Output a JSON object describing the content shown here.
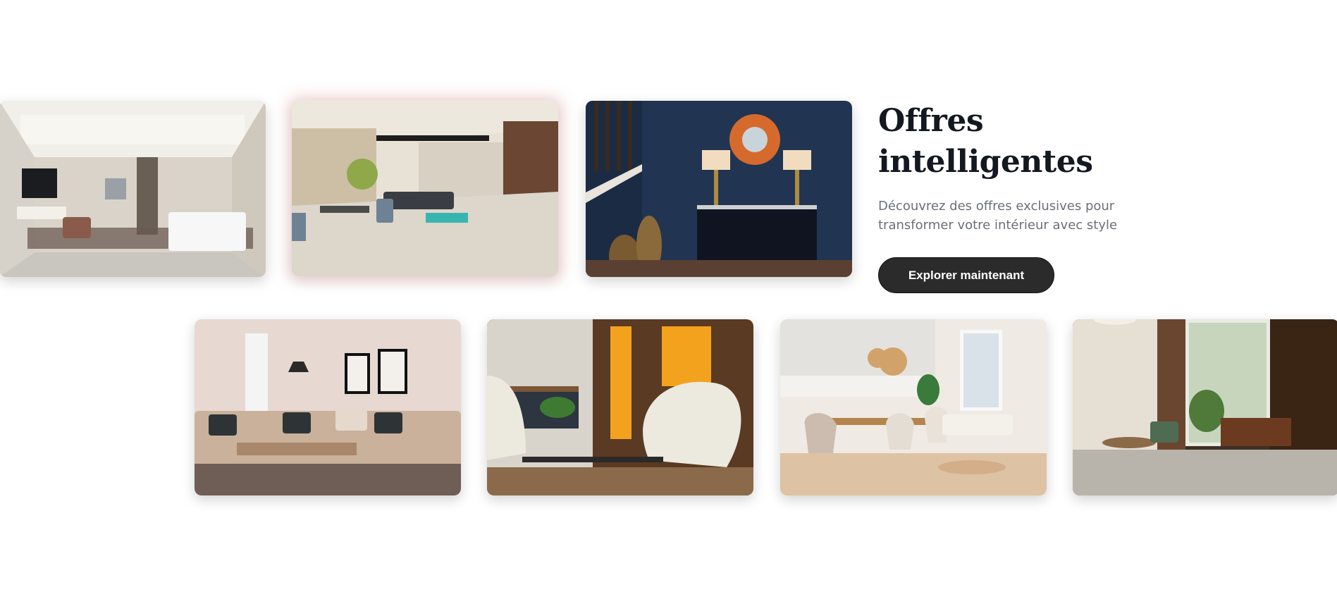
{
  "promo": {
    "title": "Offres intelligentes",
    "description": "Découvrez des offres exclusives pour transformer votre intérieur avec style",
    "cta_label": "Explorer maintenant"
  },
  "gallery": {
    "row_1": [
      {
        "name": "living-room-tv-wall-photo"
      },
      {
        "name": "open-living-dining-photo",
        "highlighted": true
      },
      {
        "name": "navy-console-mirror-photo"
      }
    ],
    "row_2": [
      {
        "name": "beige-sofa-living-photo"
      },
      {
        "name": "egg-chair-shelves-photo"
      },
      {
        "name": "kitchen-dining-photo"
      },
      {
        "name": "hotel-lounge-photo"
      }
    ]
  },
  "colors": {
    "cta_background": "#2b2b2b",
    "title_text": "#141821",
    "description_text": "#6b6f76"
  }
}
